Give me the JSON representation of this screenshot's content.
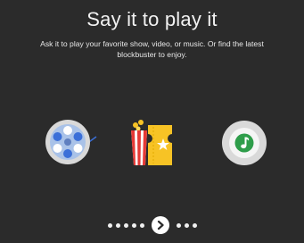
{
  "header": {
    "title": "Say it to play it",
    "subtitle": "Ask it to play your favorite show, video, or music. Or find the latest blockbuster to enjoy."
  },
  "icons": [
    {
      "name": "film-reel-icon"
    },
    {
      "name": "popcorn-ticket-icon"
    },
    {
      "name": "music-note-icon"
    }
  ],
  "pager": {
    "dots_before": 5,
    "dots_after": 3,
    "next_icon": "chevron-right-icon"
  },
  "colors": {
    "background": "#2b2b2b",
    "reel_blue": "#3b6fd8",
    "ticket_yellow": "#f7c325",
    "popcorn_red": "#e53935",
    "music_green": "#2e9d4a"
  }
}
